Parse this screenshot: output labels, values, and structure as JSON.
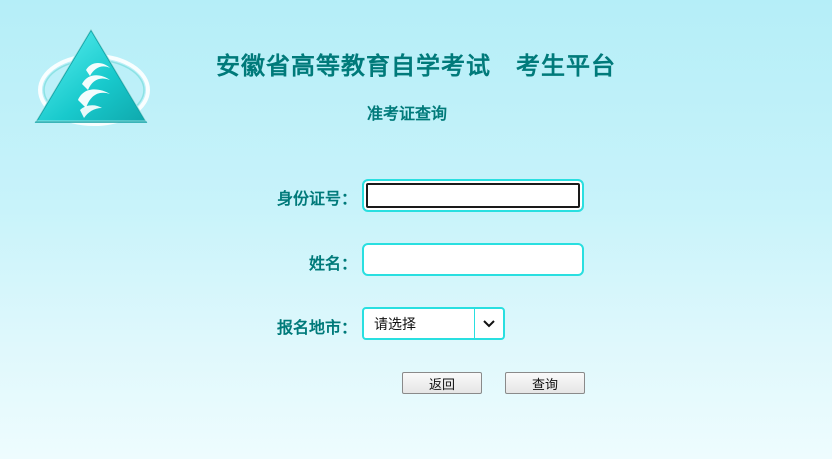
{
  "header": {
    "title": "安徽省高等教育自学考试　考生平台",
    "subtitle": "准考证查询",
    "logo_icon": "triangle-flame-logo-icon"
  },
  "form": {
    "id_label": "身份证号：",
    "id_value": "",
    "name_label": "姓名：",
    "name_value": "",
    "city_label": "报名地市：",
    "city_selected": "请选择",
    "city_arrow_icon": "chevron-down-icon"
  },
  "buttons": {
    "back_label": "返回",
    "query_label": "查询"
  },
  "colors": {
    "accent": "#29dfe0",
    "label_text": "#007a7a",
    "background_top": "#b5eef8",
    "background_bottom": "#eefcfe"
  }
}
